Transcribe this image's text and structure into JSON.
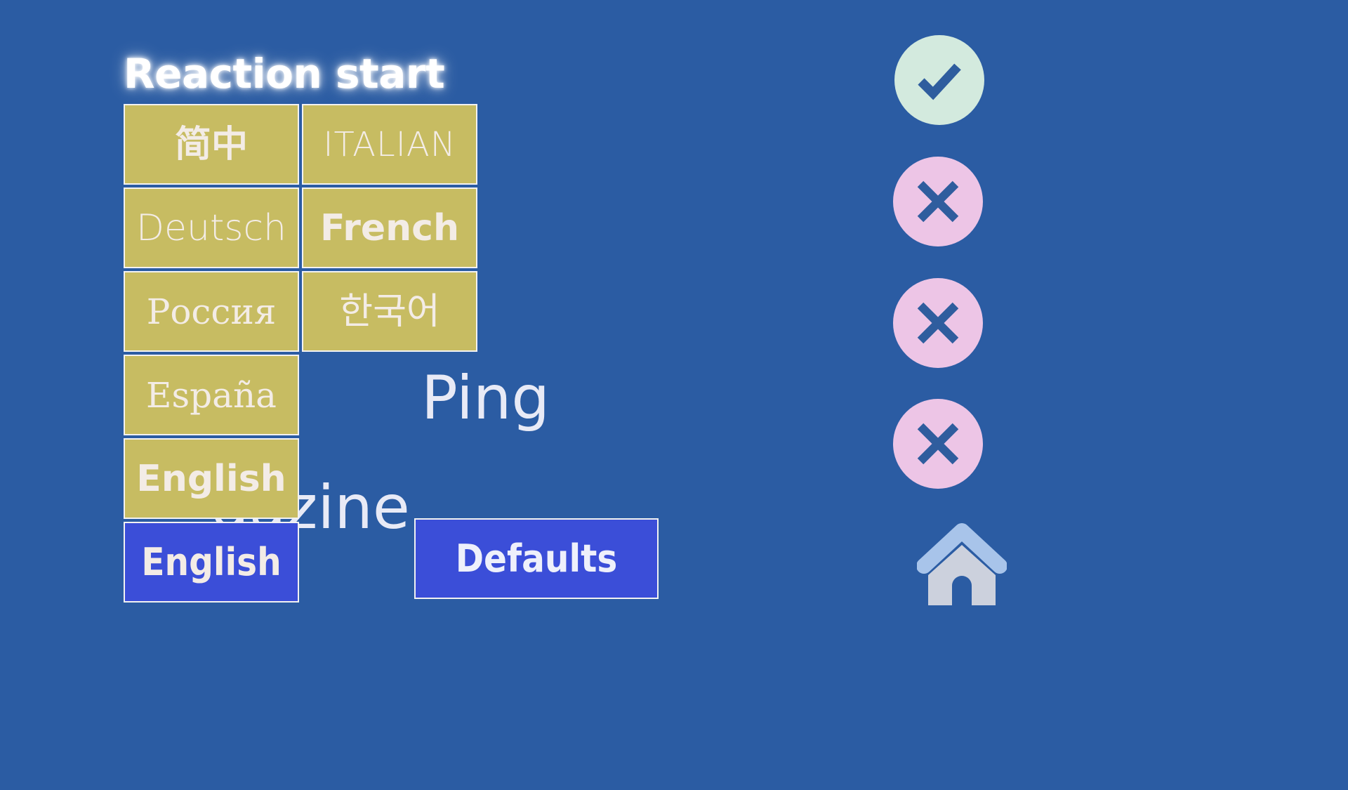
{
  "screen": {
    "title": "Reaction start",
    "background_color": "#2b5ca3",
    "tile_color": "#c7bc62",
    "selected_color": "#3b4ed8",
    "tile_text_color": "#f3ece6"
  },
  "background_labels": [
    {
      "name": "ping-label",
      "text": "Ping"
    },
    {
      "name": "magazine-label",
      "text": "gazine"
    }
  ],
  "language_grid": {
    "rows": [
      [
        {
          "label": "简中",
          "style": "f-cjk",
          "selected": false
        },
        {
          "label": "ITALIAN",
          "style": "f-thin",
          "selected": false
        }
      ],
      [
        {
          "label": "Deutsch",
          "style": "f-thin-lg",
          "selected": false
        },
        {
          "label": "French",
          "style": "f-bold",
          "selected": false
        }
      ],
      [
        {
          "label": "Россия",
          "style": "f-serif",
          "selected": false
        },
        {
          "label": "한국어",
          "style": "f-thin-lg",
          "selected": false
        }
      ],
      [
        {
          "label": "España",
          "style": "f-serif",
          "selected": false
        },
        {
          "label": "",
          "style": "spacer",
          "selected": false
        }
      ],
      [
        {
          "label": "English",
          "style": "f-bold",
          "selected": false
        },
        {
          "label": "",
          "style": "spacer",
          "selected": false
        }
      ],
      [
        {
          "label": "English",
          "style": "f-cond",
          "selected": true
        },
        {
          "label": "",
          "style": "spacer",
          "selected": false
        }
      ]
    ]
  },
  "defaults_button": {
    "label": "Defaults",
    "color": "#3b4ed8"
  },
  "icon_rail": {
    "items": [
      {
        "name": "confirm-icon",
        "glyph": "check",
        "circle_color": "#d3eade",
        "mark_color": "#2f5d9e"
      },
      {
        "name": "close-icon-1",
        "glyph": "cross",
        "circle_color": "#edc5e6",
        "mark_color": "#2f5d9e"
      },
      {
        "name": "close-icon-2",
        "glyph": "cross",
        "circle_color": "#edc5e6",
        "mark_color": "#2f5d9e"
      },
      {
        "name": "close-icon-3",
        "glyph": "cross",
        "circle_color": "#edc5e6",
        "mark_color": "#2f5d9e"
      },
      {
        "name": "home-icon",
        "glyph": "home",
        "roof_color": "#a8c4ea",
        "body_color": "#ccd1dd"
      }
    ]
  }
}
